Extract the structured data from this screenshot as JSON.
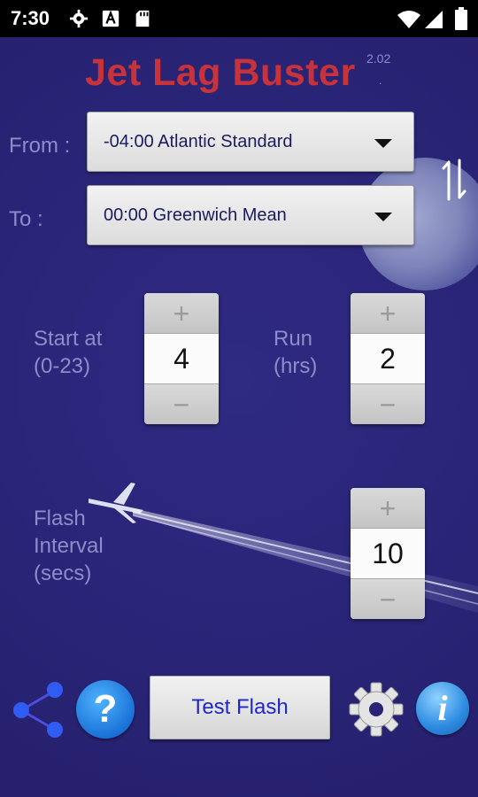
{
  "status_bar": {
    "time": "7:30",
    "icons": [
      "gear-icon",
      "a-icon",
      "sd-card-icon",
      "wifi-icon",
      "signal-icon",
      "battery-icon"
    ]
  },
  "app": {
    "title": "Jet Lag Buster",
    "version": "2.02",
    "version_dot": "."
  },
  "timezones": {
    "from_label": "From :",
    "from_value": "-04:00 Atlantic Standard",
    "to_label": "To :",
    "to_value": "00:00 Greenwich Mean"
  },
  "start": {
    "label_line1": "Start at",
    "label_line2": "(0-23)",
    "value": "4",
    "plus": "+",
    "minus": "−"
  },
  "run": {
    "label_line1": "Run",
    "label_line2": "(hrs)",
    "value": "2",
    "plus": "+",
    "minus": "−"
  },
  "flash": {
    "label_line1": "Flash",
    "label_line2": "Interval",
    "label_line3": "(secs)",
    "value": "10",
    "plus": "+",
    "minus": "−"
  },
  "bottom": {
    "help_glyph": "?",
    "test_flash_label": "Test Flash",
    "info_glyph": "i"
  },
  "colors": {
    "background": "#2a2477",
    "title": "#c8323a",
    "label": "#8f8cc8",
    "button_text": "#1f27c8"
  }
}
